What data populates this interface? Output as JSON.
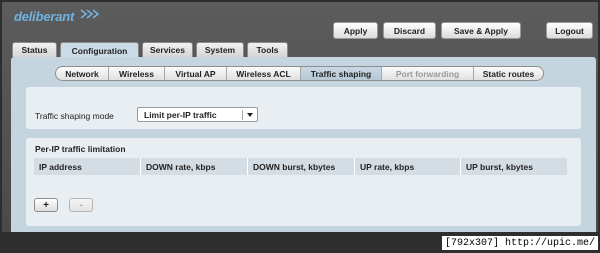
{
  "logo": {
    "text": "deliberant"
  },
  "header": {
    "apply_label": "Apply",
    "discard_label": "Discard",
    "save_apply_label": "Save & Apply",
    "logout_label": "Logout"
  },
  "main_tabs": [
    {
      "label": "Status"
    },
    {
      "label": "Configuration",
      "active": true
    },
    {
      "label": "Services"
    },
    {
      "label": "System"
    },
    {
      "label": "Tools"
    }
  ],
  "sub_tabs": [
    {
      "label": "Network"
    },
    {
      "label": "Wireless"
    },
    {
      "label": "Virtual AP"
    },
    {
      "label": "Wireless ACL"
    },
    {
      "label": "Traffic shaping",
      "active": true
    },
    {
      "label": "Port forwarding",
      "disabled": true
    },
    {
      "label": "Static routes"
    }
  ],
  "shaping": {
    "mode_label": "Traffic shaping mode",
    "mode_value": "Limit per-IP traffic"
  },
  "limitation": {
    "title": "Per-IP traffic limitation",
    "columns": [
      "IP address",
      "DOWN rate, kbps",
      "DOWN burst, kbytes",
      "UP rate, kbps",
      "UP burst, kbytes"
    ],
    "add_label": "+",
    "remove_label": "-"
  },
  "watermark": "[792x307] http://upic.me/",
  "colors": {
    "logo": "#6fb3e0",
    "panel": "#c5d5e0",
    "box": "#e9eef2",
    "active_tab": "#cbdbe6"
  }
}
